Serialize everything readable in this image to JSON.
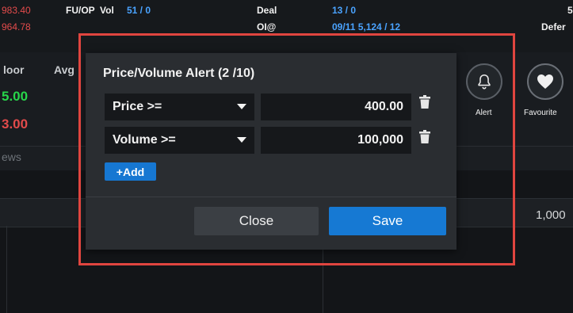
{
  "header": {
    "price_red_1": "983.40",
    "price_red_2": "964.78",
    "fu_op_label": "FU/OP",
    "vol_label": "Vol",
    "vol_value": "51 / 0",
    "deal_label": "Deal",
    "deal_value": "13 / 0",
    "oi_label": "OI@",
    "oi_value": "09/11 5,124 / 12",
    "right_partial_label": "Defer",
    "right_partial_top": "5"
  },
  "stats": {
    "floor_label": "loor",
    "avg_label": "Avg",
    "value_green": "5.00",
    "value_red": "3.00"
  },
  "news": {
    "label": "ews"
  },
  "grid": {
    "right_value": "1,000"
  },
  "actions": {
    "alert_label": "Alert",
    "favourite_label": "Favourite"
  },
  "modal": {
    "title": "Price/Volume Alert (2 /10)",
    "rows": [
      {
        "field": "Price >=",
        "value": "400.00"
      },
      {
        "field": "Volume >=",
        "value": "100,000"
      }
    ],
    "add_label": "+Add",
    "close_label": "Close",
    "save_label": "Save"
  },
  "colors": {
    "highlight": "#e0453f",
    "primary": "#1677d2",
    "up": "#27d64a",
    "down": "#e34b4b"
  }
}
